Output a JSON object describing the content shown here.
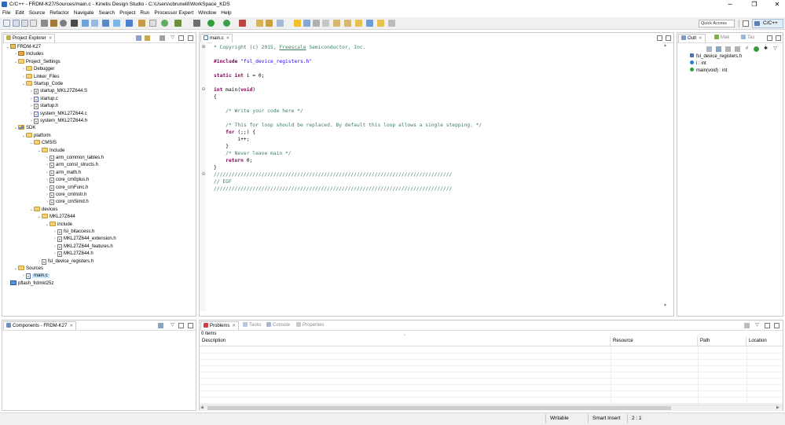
{
  "window": {
    "title": "C/C++ - FRDM-K27/Sources/main.c - Kinetis Design Studio - C:\\Users\\cbrunelli\\WorkSpace_KDS",
    "minimize": "─",
    "maximize": "❐",
    "close": "✕"
  },
  "menu": [
    "File",
    "Edit",
    "Source",
    "Refactor",
    "Navigate",
    "Search",
    "Project",
    "Run",
    "Processor Expert",
    "Window",
    "Help"
  ],
  "toolbar": {
    "quick_access_placeholder": "Quick Access",
    "perspective": "C/C++"
  },
  "project_explorer": {
    "title": "Project Explorer",
    "tree": [
      {
        "label": "FRDM-K27",
        "icon": "project-icon",
        "depth": 0,
        "expanded": true
      },
      {
        "label": "Includes",
        "icon": "includes-icon",
        "depth": 1,
        "expanded": false
      },
      {
        "label": "Project_Settings",
        "icon": "folder-icon",
        "depth": 1,
        "expanded": true
      },
      {
        "label": "Debugger",
        "icon": "folder-icon",
        "depth": 2,
        "expanded": false
      },
      {
        "label": "Linker_Files",
        "icon": "folder-icon",
        "depth": 2,
        "expanded": false
      },
      {
        "label": "Startup_Code",
        "icon": "folder-icon",
        "depth": 2,
        "expanded": true
      },
      {
        "label": "startup_MKL27Z644.S",
        "icon": "asm-file-icon",
        "depth": 3,
        "expanded": false
      },
      {
        "label": "startup.c",
        "icon": "c-file-icon",
        "depth": 3,
        "expanded": false
      },
      {
        "label": "startup.h",
        "icon": "h-file-icon",
        "depth": 3,
        "expanded": false
      },
      {
        "label": "system_MKL27Z644.c",
        "icon": "c-file-icon",
        "depth": 3,
        "expanded": false
      },
      {
        "label": "system_MKL27Z644.h",
        "icon": "h-file-icon",
        "depth": 3,
        "expanded": false
      },
      {
        "label": "SDK",
        "icon": "lib-folder-icon",
        "depth": 1,
        "expanded": true
      },
      {
        "label": "platform",
        "icon": "folder-icon",
        "depth": 2,
        "expanded": true
      },
      {
        "label": "CMSIS",
        "icon": "folder-icon",
        "depth": 3,
        "expanded": true
      },
      {
        "label": "Include",
        "icon": "folder-icon",
        "depth": 4,
        "expanded": true
      },
      {
        "label": "arm_common_tables.h",
        "icon": "h-file-icon",
        "depth": 5,
        "expanded": false
      },
      {
        "label": "arm_const_structs.h",
        "icon": "h-file-icon",
        "depth": 5,
        "expanded": false
      },
      {
        "label": "arm_math.h",
        "icon": "h-file-icon",
        "depth": 5,
        "expanded": false
      },
      {
        "label": "core_cm0plus.h",
        "icon": "h-file-icon",
        "depth": 5,
        "expanded": false
      },
      {
        "label": "core_cmFunc.h",
        "icon": "h-file-icon",
        "depth": 5,
        "expanded": false
      },
      {
        "label": "core_cmInstr.h",
        "icon": "h-file-icon",
        "depth": 5,
        "expanded": false
      },
      {
        "label": "core_cmSimd.h",
        "icon": "h-file-icon",
        "depth": 5,
        "expanded": false
      },
      {
        "label": "devices",
        "icon": "folder-icon",
        "depth": 3,
        "expanded": true
      },
      {
        "label": "MKL27Z644",
        "icon": "folder-icon",
        "depth": 4,
        "expanded": true
      },
      {
        "label": "include",
        "icon": "folder-icon",
        "depth": 5,
        "expanded": true
      },
      {
        "label": "fsl_bitaccess.h",
        "icon": "h-file-icon",
        "depth": 6,
        "expanded": false
      },
      {
        "label": "MKL27Z644_extension.h",
        "icon": "h-file-icon",
        "depth": 6,
        "expanded": false
      },
      {
        "label": "MKL27Z644_features.h",
        "icon": "h-file-icon",
        "depth": 6,
        "expanded": false
      },
      {
        "label": "MKL27Z644.h",
        "icon": "h-file-icon",
        "depth": 6,
        "expanded": false
      },
      {
        "label": "fsl_device_registers.h",
        "icon": "h-file-icon",
        "depth": 4,
        "expanded": false
      },
      {
        "label": "Sources",
        "icon": "folder-icon",
        "depth": 1,
        "expanded": true
      },
      {
        "label": "main.c",
        "icon": "c-file-icon",
        "depth": 2,
        "expanded": false,
        "selected": true
      },
      {
        "label": "pflash_frdmkl25z",
        "icon": "launch-icon",
        "depth": 0,
        "expanded": false
      }
    ]
  },
  "components": {
    "title": "Components - FRDM-K27"
  },
  "editor": {
    "tab_label": "main.c",
    "lines": [
      {
        "parts": [
          {
            "t": "* Copyright (c) 2015, ",
            "c": "cm"
          },
          {
            "t": "Freescale",
            "c": "cm u"
          },
          {
            "t": " Semiconductor, Inc.",
            "c": "cm"
          }
        ],
        "fold": "+"
      },
      {
        "parts": []
      },
      {
        "parts": [
          {
            "t": "#include ",
            "c": "kw"
          },
          {
            "t": "\"fsl_device_registers.h\"",
            "c": "str"
          }
        ]
      },
      {
        "parts": []
      },
      {
        "parts": [
          {
            "t": "static",
            "c": "kw"
          },
          {
            "t": " "
          },
          {
            "t": "int",
            "c": "kw"
          },
          {
            "t": " i = 0;"
          }
        ]
      },
      {
        "parts": []
      },
      {
        "parts": [
          {
            "t": "int",
            "c": "kw"
          },
          {
            "t": " main("
          },
          {
            "t": "void",
            "c": "kw"
          },
          {
            "t": ")"
          }
        ],
        "fold": "−"
      },
      {
        "parts": [
          {
            "t": "{"
          }
        ]
      },
      {
        "parts": []
      },
      {
        "parts": [
          {
            "t": "    "
          },
          {
            "t": "/* Write your code here */",
            "c": "cm"
          }
        ]
      },
      {
        "parts": []
      },
      {
        "parts": [
          {
            "t": "    "
          },
          {
            "t": "/* This for loop should be replaced. By default this loop allows a single stepping. */",
            "c": "cm"
          }
        ]
      },
      {
        "parts": [
          {
            "t": "    "
          },
          {
            "t": "for",
            "c": "kw"
          },
          {
            "t": " (;;) {"
          }
        ]
      },
      {
        "parts": [
          {
            "t": "        i++;"
          }
        ]
      },
      {
        "parts": [
          {
            "t": "    }"
          }
        ]
      },
      {
        "parts": [
          {
            "t": "    "
          },
          {
            "t": "/* Never leave main */",
            "c": "cm"
          }
        ]
      },
      {
        "parts": [
          {
            "t": "    "
          },
          {
            "t": "return",
            "c": "kw"
          },
          {
            "t": " 0;"
          }
        ]
      },
      {
        "parts": [
          {
            "t": "}"
          }
        ]
      },
      {
        "parts": [
          {
            "t": "////////////////////////////////////////////////////////////////////////////////",
            "c": "cm"
          }
        ],
        "fold": "−"
      },
      {
        "parts": [
          {
            "t": "// EOF",
            "c": "cm"
          }
        ]
      },
      {
        "parts": [
          {
            "t": "////////////////////////////////////////////////////////////////////////////////",
            "c": "cm"
          }
        ]
      }
    ]
  },
  "outline": {
    "tabs": [
      "Outl",
      "Mak",
      "Tas"
    ],
    "items": [
      {
        "label": "fsl_device_registers.h",
        "type": "include"
      },
      {
        "label": "i : int",
        "type": "variable"
      },
      {
        "label": "main(void) : int",
        "type": "function"
      }
    ]
  },
  "problems": {
    "tabs": [
      {
        "label": "Problems",
        "active": true
      },
      {
        "label": "Tasks",
        "active": false
      },
      {
        "label": "Console",
        "active": false
      },
      {
        "label": "Properties",
        "active": false
      }
    ],
    "count": "0 items",
    "columns": [
      "Description",
      "Resource",
      "Path",
      "Location"
    ]
  },
  "status": {
    "mode": "Writable",
    "insert": "Smart Insert",
    "position": "2 : 1"
  },
  "colors": {
    "accent": "#2b6cb8",
    "selection": "#cce8ff",
    "keyword": "#7f0055",
    "string": "#2a00ff",
    "comment": "#3f7f5f"
  }
}
